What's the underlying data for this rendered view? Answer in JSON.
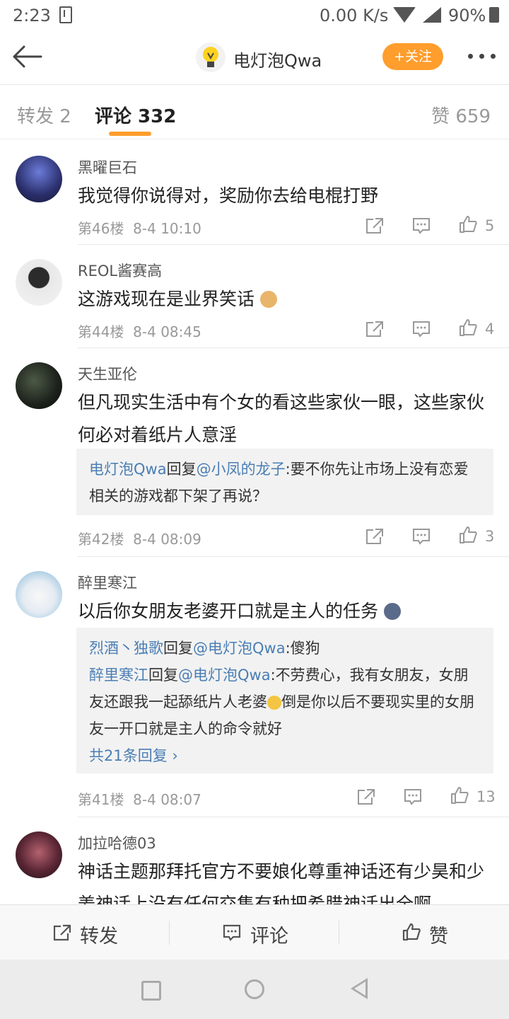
{
  "status_bar": {
    "time": "2:23",
    "network_speed": "0.00 K/s",
    "battery": "90%"
  },
  "header": {
    "title": "电灯泡Qwa",
    "follow_label": "+关注"
  },
  "tabs": {
    "repost": "转发 2",
    "comments": "评论 332",
    "likes": "赞 659"
  },
  "comments": [
    {
      "user": "黑曜巨石",
      "text": "我觉得你说得对，奖励你去给电棍打野",
      "floor": "第46楼",
      "time": "8-4 10:10",
      "likes": "5"
    },
    {
      "user": "REOL酱赛高",
      "text": "这游戏现在是业界笑话",
      "floor": "第44楼",
      "time": "8-4 08:45",
      "likes": "4"
    },
    {
      "user": "天生亚伦",
      "text": "但凡现实生活中有个女的看这些家伙一眼，这些家伙何必对着纸片人意淫",
      "reply": {
        "from": "电灯泡Qwa",
        "verb": "回复",
        "to": "@小凤的龙子",
        "text": ":要不你先让市场上没有恋爱相关的游戏都下架了再说？"
      },
      "floor": "第42楼",
      "time": "8-4 08:09",
      "likes": "3"
    },
    {
      "user": "醉里寒江",
      "text": "以后你女朋友老婆开口就是主人的任务",
      "replies": [
        {
          "from": "烈酒丶独歌",
          "verb": "回复",
          "to": "@电灯泡Qwa",
          "text": ":傻狗"
        },
        {
          "from": "醉里寒江",
          "verb": "回复",
          "to": "@电灯泡Qwa",
          "text_a": ":不劳费心，我有女朋友，女朋友还跟我一起舔纸片人老婆",
          "text_b": "倒是你以后不要现实里的女朋友一开口就是主人的命令就好"
        }
      ],
      "more_replies": "共21条回复",
      "floor": "第41楼",
      "time": "8-4 08:07",
      "likes": "13"
    },
    {
      "user": "加拉哈德03",
      "text": "神话主题那拜托官方不要娘化尊重神话还有少昊和少姜神话上没有任何交集有种把希腊神话出全啊"
    }
  ],
  "bottom_bar": {
    "repost": "转发",
    "comment": "评论",
    "like": "赞"
  },
  "colors": {
    "accent": "#ff9d2d",
    "link": "#4a7eb4"
  }
}
